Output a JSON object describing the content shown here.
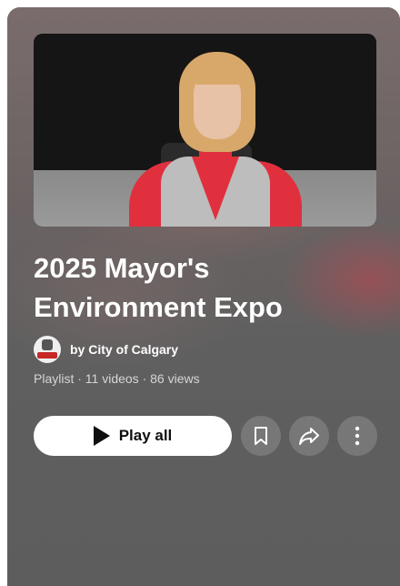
{
  "playlist": {
    "title_line1": "2025 Mayor's",
    "title_line2": "Environment Expo",
    "channel": "by City of Calgary",
    "meta": "Playlist · 11 videos · 86 views",
    "thumbnail_icon": "video-thumbnail"
  },
  "actions": {
    "play_all_label": "Play all",
    "play_icon": "play-icon",
    "save_icon": "bookmark-icon",
    "share_icon": "share-icon",
    "more_icon": "more-vertical-icon"
  },
  "colors": {
    "panel": "#5e5e5e",
    "button_bg": "#ffffff",
    "accent_red": "#e0303e"
  }
}
